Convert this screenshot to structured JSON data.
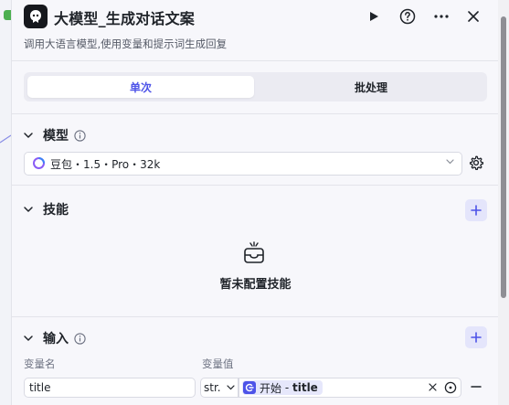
{
  "header": {
    "title": "大模型_生成对话文案",
    "subtitle": "调用大语言模型,使用变量和提示词生成回复"
  },
  "tabs": [
    {
      "label": "单次",
      "active": true
    },
    {
      "label": "批处理",
      "active": false
    }
  ],
  "model_section": {
    "title": "模型",
    "selected_model": "豆包・1.5・Pro・32k"
  },
  "skills_section": {
    "title": "技能",
    "empty_text": "暂未配置技能"
  },
  "input_section": {
    "title": "输入",
    "col_name": "变量名",
    "col_value": "变量值",
    "rows": [
      {
        "name": "title",
        "type": "str.",
        "ref_node": "开始",
        "ref_sep": " - ",
        "ref_var": "title"
      }
    ]
  },
  "colors": {
    "accent": "#4d53e8",
    "panel_bg": "#f7f7fb",
    "canvas_node": "#4caf50"
  }
}
